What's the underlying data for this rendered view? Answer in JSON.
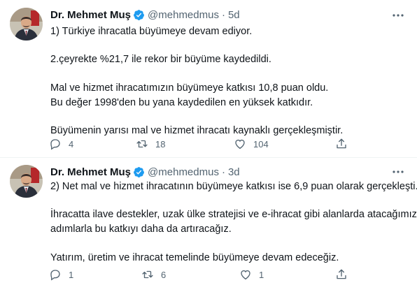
{
  "tweets": [
    {
      "author": {
        "name": "Dr. Mehmet Muş",
        "handle": "@mehmedmus"
      },
      "separator": "·",
      "time": "5d",
      "lines": [
        "1) Türkiye ihracatla büyümeye devam ediyor.",
        "2.çeyrekte %21,7 ile rekor bir büyüme kaydedildi.",
        "Mal ve hizmet ihracatımızın büyümeye katkısı 10,8 puan oldu.",
        "Bu değer 1998'den bu yana kaydedilen en yüksek katkıdır.",
        "Büyümenin yarısı mal ve hizmet ihracatı kaynaklı gerçekleşmiştir."
      ],
      "stats": {
        "replies": "4",
        "retweets": "18",
        "likes": "104"
      }
    },
    {
      "author": {
        "name": "Dr. Mehmet Muş",
        "handle": "@mehmedmus"
      },
      "separator": "·",
      "time": "3d",
      "lines": [
        "2) Net mal ve hizmet ihracatının büyümeye katkısı ise 6,9 puan olarak gerçekleşti.",
        "İhracatta ilave destekler, uzak ülke stratejisi ve e-ihracat gibi alanlarda atacağımız",
        "adımlarla bu katkıyı daha da artıracağız.",
        "Yatırım, üretim ve ihracat temelinde büyümeye devam edeceğiz."
      ],
      "stats": {
        "replies": "1",
        "retweets": "6",
        "likes": "1"
      }
    }
  ],
  "colors": {
    "text": "#0f1419",
    "muted": "#536471",
    "verified": "#1d9bf0",
    "divider": "#eff3f4"
  },
  "icons": [
    "avatar-photo",
    "verified-badge-icon",
    "more-options-icon",
    "reply-icon",
    "retweet-icon",
    "like-icon",
    "share-icon"
  ]
}
